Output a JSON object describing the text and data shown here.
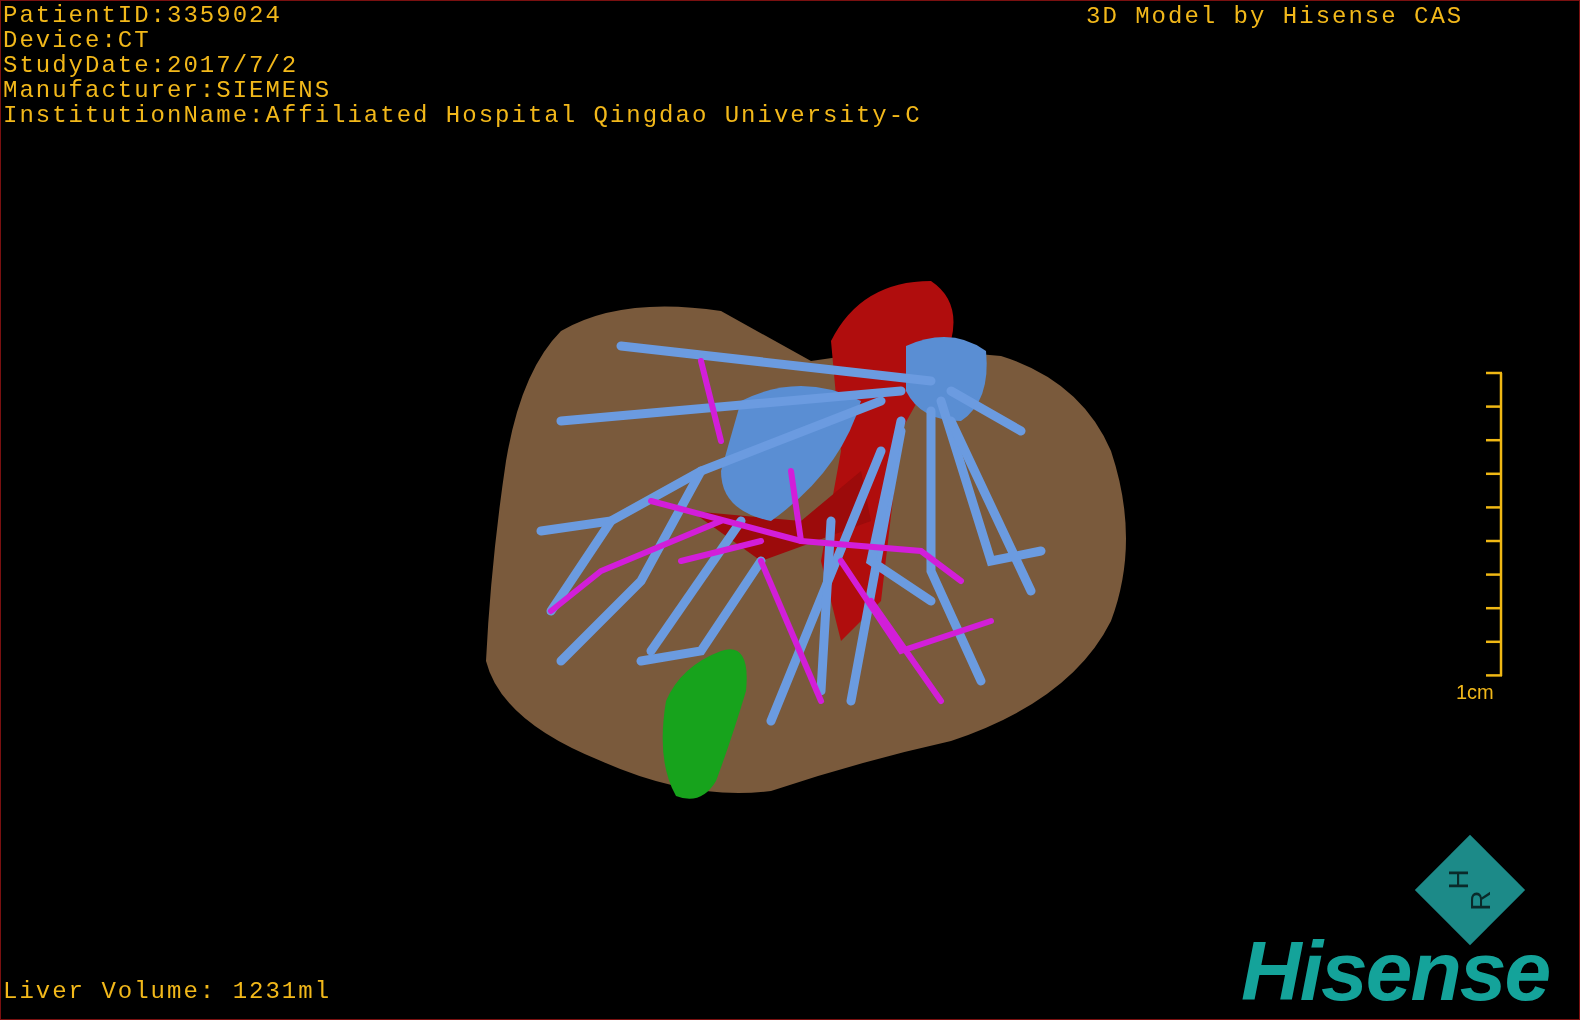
{
  "patient_info": [
    "PatientID:3359024",
    "Device:CT",
    "StudyDate:2017/7/2",
    "Manufacturer:SIEMENS",
    "InstitutionName:Affiliated Hospital Qingdao University-C"
  ],
  "model_credit": "3D Model by Hisense CAS",
  "scale_bar": {
    "label": "1cm"
  },
  "liver_volume": "Liver Volume: 1231ml",
  "orientation_cube": {
    "labels": [
      "H",
      "R"
    ]
  },
  "logo": "Hisense"
}
